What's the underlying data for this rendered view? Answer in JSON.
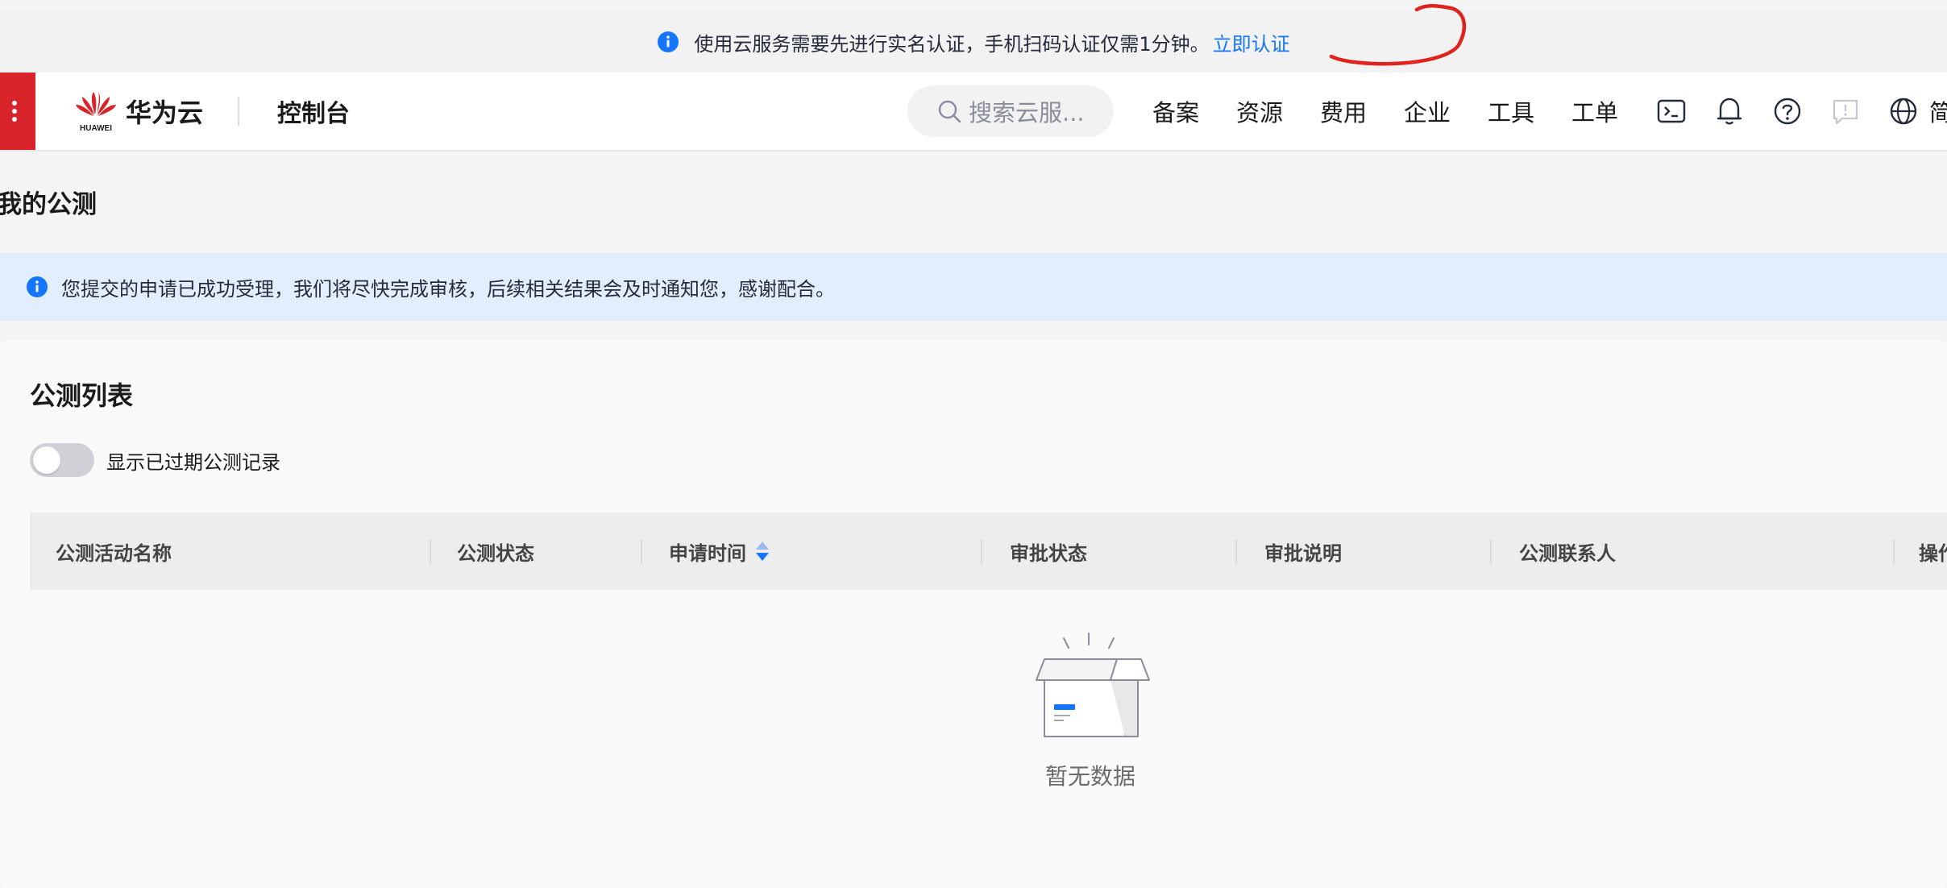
{
  "notice": {
    "text": "使用云服务需要先进行实名认证，手机扫码认证仅需1分钟。",
    "link": "立即认证"
  },
  "header": {
    "logo_text": "HUAWEI",
    "brand": "华为云",
    "console": "控制台",
    "search_placeholder": "搜索云服...",
    "nav": [
      "备案",
      "资源",
      "费用",
      "企业",
      "工具",
      "工单"
    ],
    "icons": [
      "terminal-icon",
      "bell-icon",
      "help-icon",
      "feedback-icon",
      "globe-icon"
    ],
    "lang": "简"
  },
  "page": {
    "title": "我的公测"
  },
  "banner": {
    "text": "您提交的申请已成功受理，我们将尽快完成审核，后续相关结果会及时通知您，感谢配合。"
  },
  "list": {
    "title": "公测列表",
    "toggle_label": "显示已过期公测记录",
    "toggle_on": false,
    "columns": [
      "公测活动名称",
      "公测状态",
      "申请时间",
      "审批状态",
      "审批说明",
      "公测联系人",
      "操作"
    ],
    "empty_text": "暂无数据"
  },
  "colors": {
    "brand_red": "#d9242b",
    "link_blue": "#1476ff",
    "banner_bg": "#e3eefd",
    "annotation_red": "#e0231c"
  }
}
